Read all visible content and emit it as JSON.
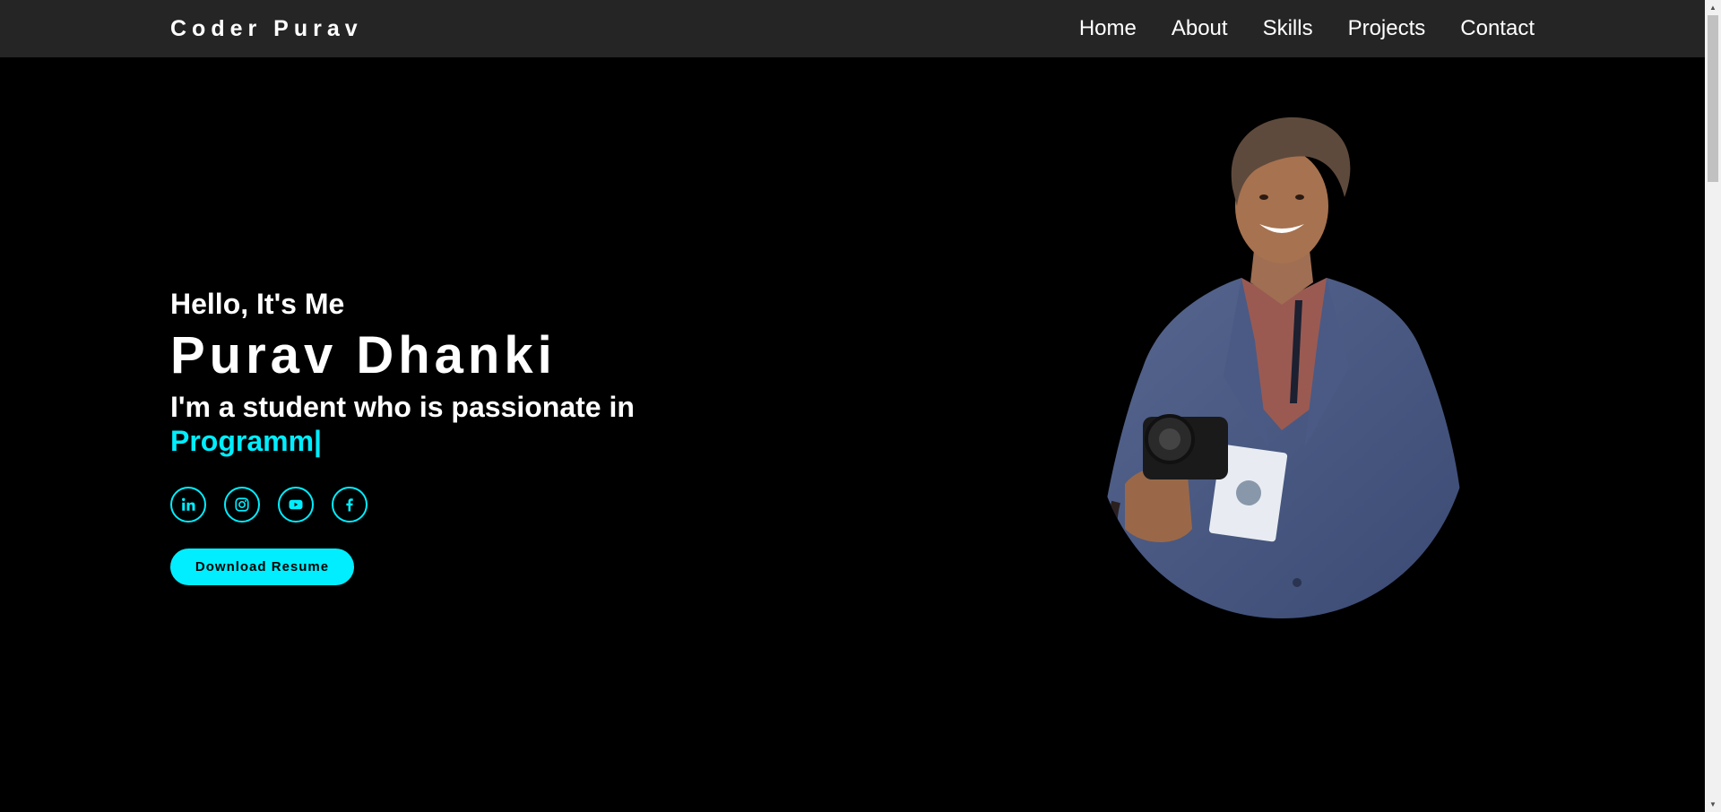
{
  "header": {
    "logo": "Coder Purav",
    "nav": [
      "Home",
      "About",
      "Skills",
      "Projects",
      "Contact"
    ]
  },
  "hero": {
    "greeting": "Hello, It's Me",
    "name": "Purav Dhanki",
    "tagline_prefix": "I'm a student who is passionate in",
    "typed_text": "Programm",
    "cursor": "|",
    "socials": [
      "linkedin-icon",
      "instagram-icon",
      "youtube-icon",
      "facebook-icon"
    ],
    "button_label": "Download Resume"
  },
  "colors": {
    "accent": "#00eeff",
    "background": "#000000",
    "header_bg": "#252525"
  }
}
